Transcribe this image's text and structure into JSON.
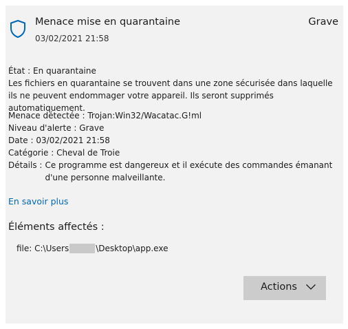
{
  "header": {
    "title": "Menace mise en quarantaine",
    "timestamp": "03/02/2021 21:58",
    "severity": "Grave",
    "icon": "shield-icon"
  },
  "status": {
    "label": "État :",
    "value": "En quarantaine",
    "description": "Les fichiers en quarantaine se trouvent dans une zone sécurisée dans laquelle ils ne peuvent endommager votre appareil. Ils seront supprimés automatiquement."
  },
  "details": {
    "threat_label": "Menace détectée :",
    "threat_value": "Trojan:Win32/Wacatac.G!ml",
    "alert_label": "Niveau d'alerte :",
    "alert_value": "Grave",
    "date_label": "Date :",
    "date_value": "03/02/2021 21:58",
    "category_label": "Catégorie :",
    "category_value": "Cheval de Troie",
    "details_label": "Détails :",
    "details_value": "Ce programme est dangereux et il exécute des commandes émanant d'une personne malveillante."
  },
  "learn_more": "En savoir plus",
  "affected": {
    "heading": "Éléments affectés :",
    "file_prefix": "file: C:\\Users",
    "file_suffix": "\\Desktop\\app.exe"
  },
  "actions": {
    "label": "Actions"
  },
  "colors": {
    "accent": "#0067b8",
    "card_background": "#f2f2f2",
    "button_background": "#cccccc"
  }
}
